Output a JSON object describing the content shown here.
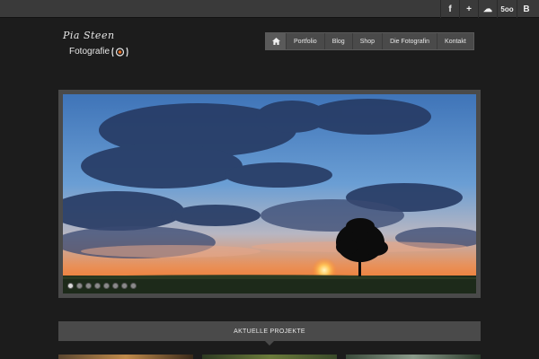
{
  "social": {
    "facebook": "f",
    "plus": "+",
    "flickr": "☁",
    "fivehundred": "5oo",
    "blogger": "B"
  },
  "logo": {
    "line1": "Pia Steen",
    "line2": "Fotografie"
  },
  "nav": {
    "items": [
      "Portfolio",
      "Blog",
      "Shop",
      "Die Fotografin",
      "Kontakt"
    ]
  },
  "slider": {
    "slide_count": 8,
    "active_index": 0
  },
  "projects": {
    "title": "AKTUELLE PROJEKTE"
  },
  "colors": {
    "background": "#1c1c1c",
    "bar": "#4a4a4a",
    "topbar": "#3a3a3a"
  }
}
